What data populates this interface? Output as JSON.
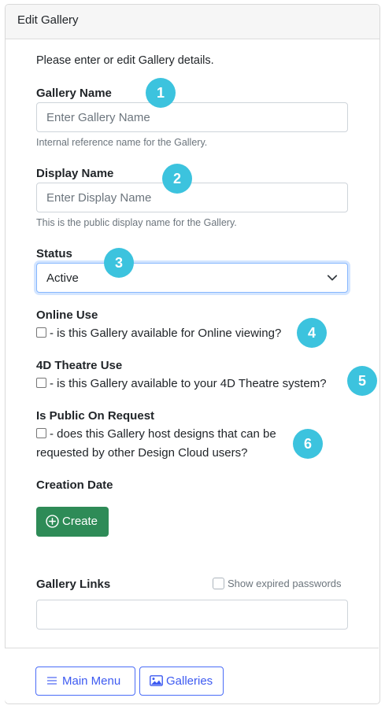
{
  "header": {
    "title": "Edit Gallery"
  },
  "intro": "Please enter or edit Gallery details.",
  "gallery_name": {
    "label": "Gallery Name",
    "placeholder": "Enter Gallery Name",
    "value": "",
    "help": "Internal reference name for the Gallery."
  },
  "display_name": {
    "label": "Display Name",
    "placeholder": "Enter Display Name",
    "value": "",
    "help": "This is the public display name for the Gallery."
  },
  "status": {
    "label": "Status",
    "selected": "Active"
  },
  "online_use": {
    "label": "Online Use",
    "text": "- is this Gallery available for Online viewing?",
    "checked": false
  },
  "theatre_use": {
    "label": "4D Theatre Use",
    "text": "- is this Gallery available to your 4D Theatre system?",
    "checked": false
  },
  "public_request": {
    "label": "Is Public On Request",
    "text_line1": "- does this Gallery host designs that can be",
    "text_line2": "requested by other Design Cloud users?",
    "checked": false
  },
  "creation_date": {
    "label": "Creation Date",
    "create_button": "Create"
  },
  "gallery_links": {
    "label": "Gallery Links",
    "show_expired_label": "Show expired passwords",
    "show_expired_checked": false,
    "value": ""
  },
  "footer": {
    "main_menu": "Main Menu",
    "galleries": "Galleries"
  },
  "badges": [
    "1",
    "2",
    "3",
    "4",
    "5",
    "6"
  ],
  "colors": {
    "badge": "#3cc3de",
    "create_button": "#2e8b57",
    "outline_button": "#4a6cf7"
  },
  "icons": {
    "create": "plus-circle-icon",
    "main_menu": "hamburger-icon",
    "galleries": "image-icon",
    "select": "chevron-down-icon"
  }
}
